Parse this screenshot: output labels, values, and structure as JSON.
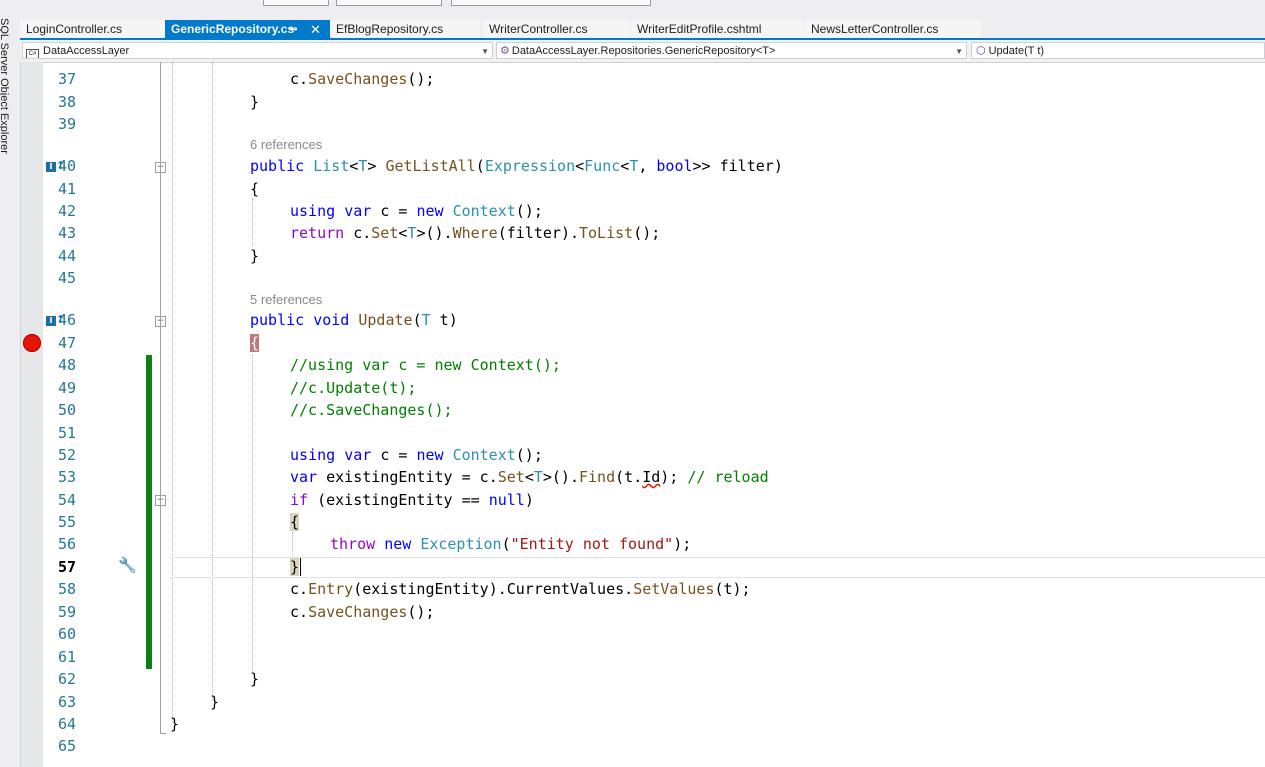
{
  "sidebar": {
    "label": "SQL Server Object Explorer"
  },
  "tabs": [
    {
      "label": "LoginController.cs",
      "active": false
    },
    {
      "label": "GenericRepository.cs",
      "active": true
    },
    {
      "label": "EfBlogRepository.cs",
      "active": false
    },
    {
      "label": "WriterController.cs",
      "active": false
    },
    {
      "label": "WriterEditProfile.cshtml",
      "active": false
    },
    {
      "label": "NewsLetterController.cs",
      "active": false
    }
  ],
  "tab_icons": {
    "pin": "⊸",
    "close": "✕"
  },
  "navbar": {
    "project": "DataAccessLayer",
    "class": "DataAccessLayer.Repositories.GenericRepository<T>",
    "member": "Update(T t)",
    "project_icon": "C#"
  },
  "references": [
    "6 references",
    "5 references"
  ],
  "line_numbers": [
    "37",
    "38",
    "39",
    "40",
    "41",
    "42",
    "43",
    "44",
    "45",
    "46",
    "47",
    "48",
    "49",
    "50",
    "51",
    "52",
    "53",
    "54",
    "55",
    "56",
    "57",
    "58",
    "59",
    "60",
    "61",
    "62",
    "63",
    "64",
    "65"
  ],
  "code": {
    "l37": {
      "obj": "c",
      "method": "SaveChanges",
      "tail": "();"
    },
    "brace_close": "}",
    "brace_open": "{",
    "sig40": {
      "mod": "public",
      "type": "List",
      "t": "T",
      "name": "GetListAll",
      "expr": "Expression",
      "func": "Func",
      "bool": "bool",
      "param": "filter"
    },
    "l42": {
      "using": "using",
      "var": "var",
      "name": "c",
      "new": "new",
      "type": "Context"
    },
    "l43": {
      "ret": "return",
      "obj": "c",
      "set": "Set",
      "t": "T",
      "where": "Where",
      "arg": "filter",
      "tolist": "ToList"
    },
    "sig46": {
      "mod": "public",
      "void": "void",
      "name": "Update",
      "t": "T",
      "param": "t"
    },
    "c48": "//using var c = new Context();",
    "c49": "//c.Update(t);",
    "c50": "//c.SaveChanges();",
    "l53": {
      "var": "var",
      "name": "existingEntity",
      "obj": "c",
      "set": "Set",
      "t": "T",
      "find": "Find",
      "arg": "t",
      "id": "Id",
      "comment": "// reload"
    },
    "l54": {
      "if": "if",
      "name": "existingEntity",
      "null": "null"
    },
    "l56": {
      "throw": "throw",
      "new": "new",
      "type": "Exception",
      "msg": "\"Entity not found\""
    },
    "l58": {
      "obj": "c",
      "entry": "Entry",
      "arg": "existingEntity",
      "cv": "CurrentValues",
      "sv": "SetValues",
      "t": "t"
    },
    "l59": {
      "obj": "c",
      "method": "SaveChanges"
    }
  },
  "colors": {
    "keyword": "#0000ff",
    "type": "#2b91af",
    "method": "#74531f",
    "comment": "#008000",
    "string": "#a31515",
    "control": "#8f08c4",
    "line_number": "#237893",
    "tab_active": "#007acc",
    "breakpoint": "#e51400",
    "change_bar": "#108010"
  },
  "current_line": "57"
}
